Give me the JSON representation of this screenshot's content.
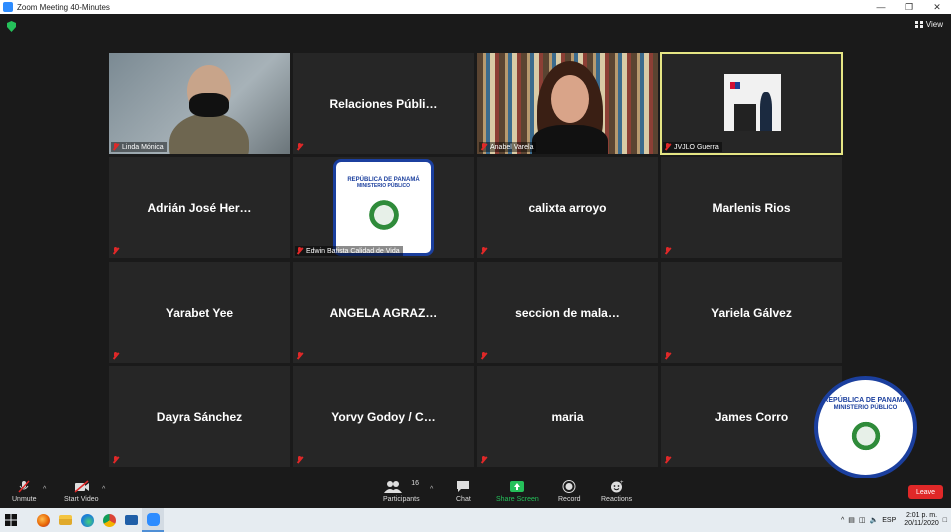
{
  "window": {
    "title": "Zoom Meeting 40-Minutes",
    "minimize": "—",
    "restore": "❐",
    "close": "✕"
  },
  "view": {
    "label": "View"
  },
  "participants": [
    {
      "name": "Linda Mónica",
      "caption": "Linda Mónica",
      "type": "video-gray"
    },
    {
      "name": "Relaciones  Públi…",
      "caption": "",
      "type": "name"
    },
    {
      "name": "Anabel Varela",
      "caption": "Anabel Varela",
      "type": "video-books"
    },
    {
      "name": "JVJLO Guerra",
      "caption": "JVJLO Guerra",
      "type": "video-podium",
      "active": true
    },
    {
      "name": "Adrián José Her…",
      "caption": "",
      "type": "name"
    },
    {
      "name": "Edwin Batista Calidad de Vida",
      "caption": "Edwin Batista Calidad de Vida",
      "type": "logo"
    },
    {
      "name": "calixta arroyo",
      "caption": "",
      "type": "name"
    },
    {
      "name": "Marlenis Rios",
      "caption": "",
      "type": "name"
    },
    {
      "name": "Yarabet Yee",
      "caption": "",
      "type": "name"
    },
    {
      "name": "ANGELA   AGRAZ…",
      "caption": "",
      "type": "name"
    },
    {
      "name": "seccion de mala…",
      "caption": "",
      "type": "name"
    },
    {
      "name": "Yariela Gálvez",
      "caption": "",
      "type": "name"
    },
    {
      "name": "Dayra Sánchez",
      "caption": "",
      "type": "name"
    },
    {
      "name": "Yorvy Godoy / C…",
      "caption": "",
      "type": "name"
    },
    {
      "name": "maria",
      "caption": "",
      "type": "name"
    },
    {
      "name": "James Corro",
      "caption": "",
      "type": "name"
    }
  ],
  "logo": {
    "line1": "REPÚBLICA DE PANAMÁ",
    "line2": "MINISTERIO PÚBLICO",
    "ring": "INSTITUTO DE MEDICINA LEGAL Y CIENCIAS FORENSES"
  },
  "toolbar": {
    "unmute": "Unmute",
    "start_video": "Start Video",
    "participants": "Participants",
    "participants_count": "16",
    "chat": "Chat",
    "share_screen": "Share Screen",
    "record": "Record",
    "reactions": "Reactions",
    "leave": "Leave"
  },
  "taskbar": {
    "language": "ESP",
    "time": "2:01 p. m.",
    "date": "20/11/2020"
  },
  "colors": {
    "active_speaker": "#e5e584",
    "share_green": "#25c05a",
    "leave_red": "#e02828",
    "logo_blue": "#1b3f9e"
  }
}
